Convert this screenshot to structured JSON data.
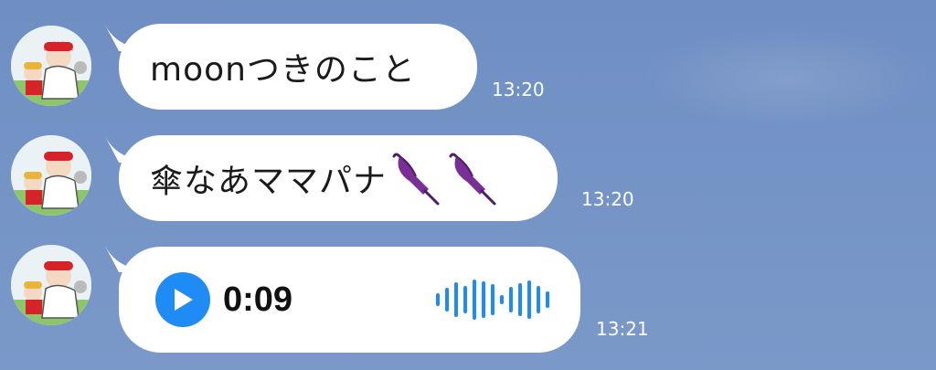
{
  "messages": [
    {
      "type": "text",
      "text": "moonつきのこと",
      "time": "13:20"
    },
    {
      "type": "text",
      "text": "傘なあママパナ",
      "emoji": [
        "umbrella-emoji",
        "umbrella-emoji"
      ],
      "time": "13:20"
    },
    {
      "type": "voice",
      "duration": "0:09",
      "time": "13:21"
    }
  ],
  "colors": {
    "background": "#7594c6",
    "bubble": "#ffffff",
    "accent": "#1f8bf5",
    "timestamp": "#ffffff"
  },
  "icons": {
    "play": "play-icon",
    "waveform": "waveform-icon",
    "avatar": "avatar-illustration"
  }
}
